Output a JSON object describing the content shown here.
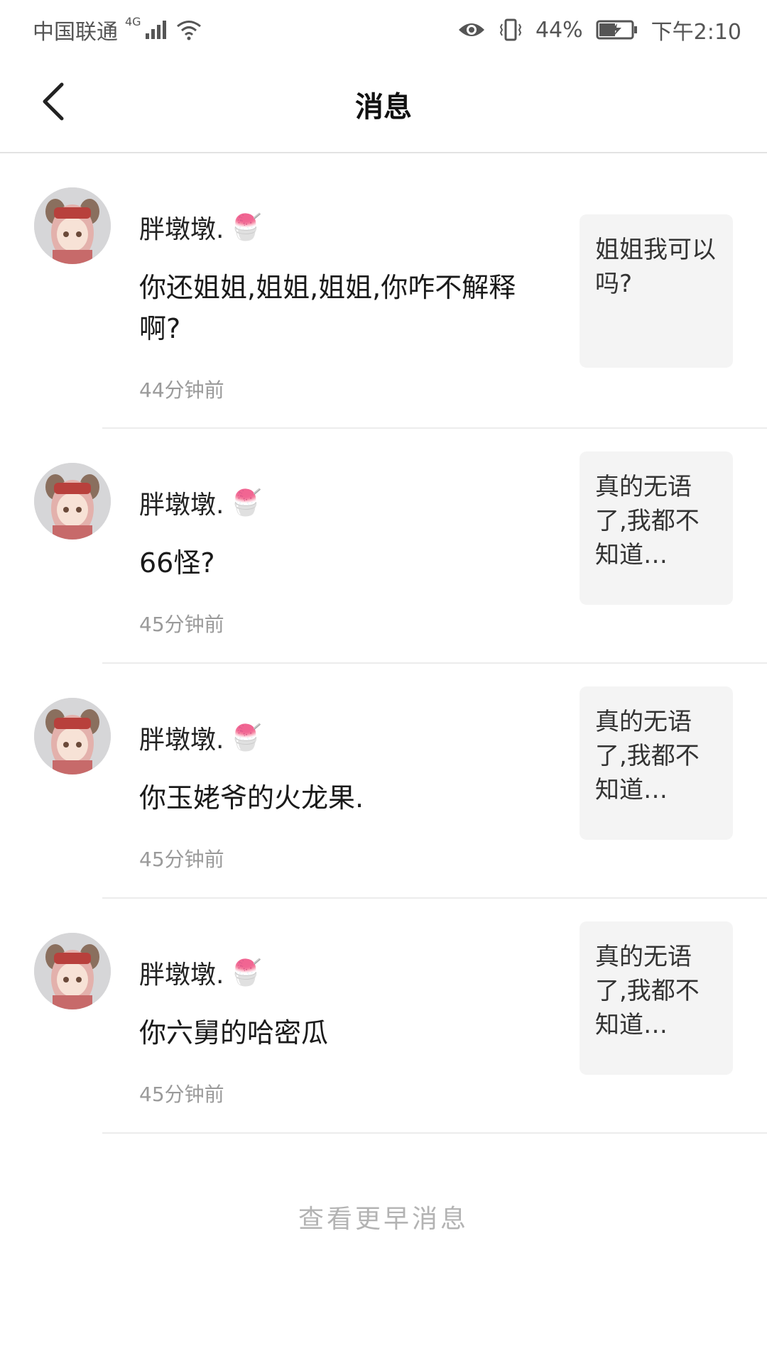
{
  "status_bar": {
    "carrier": "中国联通",
    "network": "4G",
    "battery_percent": "44%",
    "time": "下午2:10"
  },
  "header": {
    "title": "消息",
    "back_icon": "chevron-left-icon"
  },
  "messages": [
    {
      "sender": "胖墩墩.",
      "sender_emoji": "🍧",
      "text": "你还姐姐,姐姐,姐姐,你咋不解释啊?",
      "time": "44分钟前",
      "quote": "姐姐我可以吗?"
    },
    {
      "sender": "胖墩墩.",
      "sender_emoji": "🍧",
      "text": "66怪?",
      "time": "45分钟前",
      "quote": "真的无语了,我都不知道…"
    },
    {
      "sender": "胖墩墩.",
      "sender_emoji": "🍧",
      "text": "你玉姥爷的火龙果.",
      "time": "45分钟前",
      "quote": "真的无语了,我都不知道…"
    },
    {
      "sender": "胖墩墩.",
      "sender_emoji": "🍧",
      "text": "你六舅的哈密瓜",
      "time": "45分钟前",
      "quote": "真的无语了,我都不知道…"
    }
  ],
  "more_link": "查看更早消息"
}
